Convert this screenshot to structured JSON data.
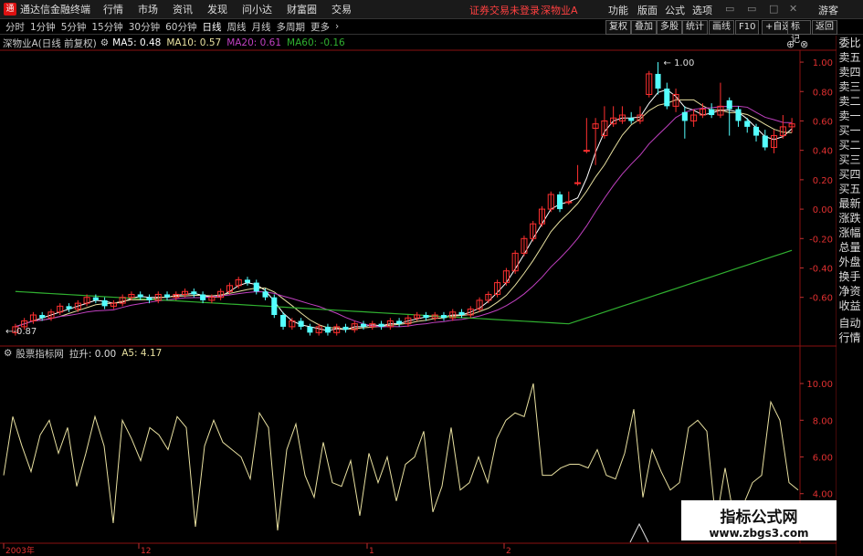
{
  "app": {
    "title": "通达信金融终端",
    "menu": [
      "行情",
      "市场",
      "资讯",
      "发现",
      "问小达",
      "财富圈",
      "交易"
    ],
    "login_status": "证券交易未登录",
    "stock_tag": "深物业A",
    "right_menu": [
      "功能",
      "版面",
      "公式",
      "选项"
    ],
    "guest": "游客"
  },
  "toolbar": {
    "periods": [
      "分时",
      "1分钟",
      "5分钟",
      "15分钟",
      "30分钟",
      "60分钟",
      "日线",
      "周线",
      "月线",
      "多周期",
      "更多"
    ],
    "active": "日线",
    "right_buttons": [
      "复权",
      "叠加",
      "多股",
      "统计",
      "画线",
      "F10",
      "+自选",
      "返回"
    ]
  },
  "main_info": {
    "title": "深物业A(日线 前复权)",
    "ma5_label": "MA5: 0.48",
    "ma10_label": "MA10: 0.57",
    "ma20_label": "MA20: 0.61",
    "ma60_label": "MA60: -0.16",
    "colors": {
      "ma5": "#ffffff",
      "ma10": "#e8e0a0",
      "ma20": "#c040c0",
      "ma60": "#30b030"
    }
  },
  "price_axis": [
    "1.00",
    "0.80",
    "0.60",
    "0.40",
    "0.20",
    "0.00",
    "-0.20",
    "-0.40",
    "-0.60"
  ],
  "annotations": {
    "high": "1.00",
    "low": "-0.87"
  },
  "sub_info": {
    "title": "股票指标网",
    "lift_label": "拉升: 0.00",
    "a5_label": "A5: 4.17"
  },
  "sub_axis": [
    "10.00",
    "8.00",
    "6.00",
    "4.00"
  ],
  "right_panel": [
    "委比",
    "卖五",
    "卖四",
    "卖三",
    "卖二",
    "卖一",
    "买一",
    "买二",
    "买三",
    "买四",
    "买五",
    "最新",
    "涨跌",
    "涨幅",
    "总量",
    "外盘",
    "换手",
    "净资",
    "收益"
  ],
  "right_panel_lower": [
    "自动",
    "行情"
  ],
  "date_labels": [
    "2003年",
    "12",
    "1",
    "2"
  ],
  "watermark": {
    "line1": "指标公式网",
    "line2": "www.zbgs3.com"
  },
  "chart_data": {
    "type": "candlestick",
    "ylim": [
      -0.9,
      1.05
    ],
    "candles": [
      [
        -0.84,
        -0.8,
        -0.78,
        -0.86
      ],
      [
        -0.8,
        -0.76,
        -0.74,
        -0.82
      ],
      [
        -0.76,
        -0.72,
        -0.7,
        -0.78
      ],
      [
        -0.72,
        -0.74,
        -0.7,
        -0.76
      ],
      [
        -0.74,
        -0.7,
        -0.68,
        -0.76
      ],
      [
        -0.7,
        -0.66,
        -0.64,
        -0.72
      ],
      [
        -0.66,
        -0.68,
        -0.64,
        -0.7
      ],
      [
        -0.68,
        -0.64,
        -0.62,
        -0.7
      ],
      [
        -0.64,
        -0.6,
        -0.58,
        -0.66
      ],
      [
        -0.6,
        -0.62,
        -0.58,
        -0.64
      ],
      [
        -0.62,
        -0.66,
        -0.6,
        -0.68
      ],
      [
        -0.66,
        -0.64,
        -0.62,
        -0.68
      ],
      [
        -0.64,
        -0.6,
        -0.58,
        -0.66
      ],
      [
        -0.6,
        -0.58,
        -0.56,
        -0.62
      ],
      [
        -0.58,
        -0.6,
        -0.56,
        -0.62
      ],
      [
        -0.6,
        -0.62,
        -0.58,
        -0.64
      ],
      [
        -0.62,
        -0.58,
        -0.56,
        -0.64
      ],
      [
        -0.58,
        -0.6,
        -0.56,
        -0.62
      ],
      [
        -0.6,
        -0.58,
        -0.56,
        -0.62
      ],
      [
        -0.58,
        -0.56,
        -0.54,
        -0.6
      ],
      [
        -0.56,
        -0.58,
        -0.54,
        -0.6
      ],
      [
        -0.58,
        -0.62,
        -0.56,
        -0.64
      ],
      [
        -0.62,
        -0.6,
        -0.58,
        -0.64
      ],
      [
        -0.6,
        -0.56,
        -0.54,
        -0.62
      ],
      [
        -0.56,
        -0.52,
        -0.5,
        -0.58
      ],
      [
        -0.52,
        -0.48,
        -0.46,
        -0.54
      ],
      [
        -0.48,
        -0.5,
        -0.46,
        -0.52
      ],
      [
        -0.5,
        -0.56,
        -0.48,
        -0.58
      ],
      [
        -0.56,
        -0.6,
        -0.54,
        -0.62
      ],
      [
        -0.6,
        -0.72,
        -0.58,
        -0.74
      ],
      [
        -0.72,
        -0.8,
        -0.7,
        -0.82
      ],
      [
        -0.8,
        -0.76,
        -0.74,
        -0.82
      ],
      [
        -0.76,
        -0.8,
        -0.74,
        -0.82
      ],
      [
        -0.8,
        -0.84,
        -0.78,
        -0.86
      ],
      [
        -0.84,
        -0.8,
        -0.78,
        -0.86
      ],
      [
        -0.8,
        -0.84,
        -0.78,
        -0.86
      ],
      [
        -0.84,
        -0.8,
        -0.78,
        -0.86
      ],
      [
        -0.8,
        -0.82,
        -0.78,
        -0.84
      ],
      [
        -0.82,
        -0.78,
        -0.76,
        -0.84
      ],
      [
        -0.78,
        -0.8,
        -0.76,
        -0.82
      ],
      [
        -0.8,
        -0.78,
        -0.76,
        -0.82
      ],
      [
        -0.78,
        -0.8,
        -0.76,
        -0.82
      ],
      [
        -0.8,
        -0.76,
        -0.74,
        -0.82
      ],
      [
        -0.76,
        -0.78,
        -0.74,
        -0.8
      ],
      [
        -0.78,
        -0.74,
        -0.72,
        -0.8
      ],
      [
        -0.74,
        -0.72,
        -0.7,
        -0.76
      ],
      [
        -0.72,
        -0.74,
        -0.7,
        -0.76
      ],
      [
        -0.74,
        -0.72,
        -0.7,
        -0.76
      ],
      [
        -0.72,
        -0.74,
        -0.7,
        -0.76
      ],
      [
        -0.74,
        -0.7,
        -0.68,
        -0.76
      ],
      [
        -0.7,
        -0.72,
        -0.68,
        -0.74
      ],
      [
        -0.72,
        -0.68,
        -0.66,
        -0.74
      ],
      [
        -0.68,
        -0.62,
        -0.6,
        -0.7
      ],
      [
        -0.62,
        -0.58,
        -0.56,
        -0.64
      ],
      [
        -0.58,
        -0.5,
        -0.48,
        -0.6
      ],
      [
        -0.5,
        -0.42,
        -0.4,
        -0.52
      ],
      [
        -0.42,
        -0.3,
        -0.28,
        -0.44
      ],
      [
        -0.3,
        -0.2,
        -0.18,
        -0.32
      ],
      [
        -0.2,
        -0.1,
        -0.08,
        -0.22
      ],
      [
        -0.1,
        0.0,
        0.02,
        -0.12
      ],
      [
        0.0,
        0.1,
        0.12,
        -0.02
      ],
      [
        0.1,
        0.0,
        0.12,
        -0.02
      ],
      [
        0.05,
        0.05,
        0.12,
        0.03
      ],
      [
        0.18,
        0.18,
        0.3,
        0.16
      ],
      [
        0.4,
        0.4,
        0.62,
        0.38
      ],
      [
        0.55,
        0.58,
        0.62,
        0.3
      ],
      [
        0.5,
        0.6,
        0.7,
        0.48
      ],
      [
        0.58,
        0.62,
        0.7,
        0.56
      ],
      [
        0.6,
        0.64,
        0.7,
        0.58
      ],
      [
        0.62,
        0.6,
        0.66,
        0.58
      ],
      [
        0.6,
        0.64,
        0.7,
        0.58
      ],
      [
        0.78,
        0.92,
        0.94,
        0.76
      ],
      [
        0.92,
        0.82,
        1.0,
        0.78
      ],
      [
        0.82,
        0.7,
        0.86,
        0.68
      ],
      [
        0.7,
        0.78,
        0.82,
        0.66
      ],
      [
        0.66,
        0.6,
        0.7,
        0.48
      ],
      [
        0.6,
        0.64,
        0.68,
        0.56
      ],
      [
        0.64,
        0.68,
        0.72,
        0.62
      ],
      [
        0.68,
        0.64,
        0.72,
        0.62
      ],
      [
        0.64,
        0.7,
        0.86,
        0.62
      ],
      [
        0.74,
        0.68,
        0.76,
        0.5
      ],
      [
        0.68,
        0.6,
        0.7,
        0.56
      ],
      [
        0.6,
        0.56,
        0.62,
        0.52
      ],
      [
        0.56,
        0.5,
        0.58,
        0.46
      ],
      [
        0.5,
        0.42,
        0.54,
        0.4
      ],
      [
        0.42,
        0.5,
        0.54,
        0.38
      ],
      [
        0.5,
        0.56,
        0.64,
        0.48
      ],
      [
        0.56,
        0.58,
        0.62,
        0.52
      ]
    ],
    "sub_values": [
      5.0,
      8.2,
      6.6,
      5.2,
      7.2,
      8.0,
      6.2,
      7.6,
      4.4,
      6.2,
      8.2,
      6.6,
      2.4,
      8.0,
      7.0,
      5.8,
      7.6,
      7.2,
      6.4,
      8.2,
      7.6,
      2.2,
      6.6,
      8.0,
      6.8,
      6.4,
      6.0,
      4.8,
      8.4,
      7.6,
      2.0,
      6.4,
      7.8,
      5.0,
      3.8,
      6.8,
      4.6,
      4.4,
      5.8,
      2.8,
      6.2,
      4.6,
      6.0,
      3.6,
      5.6,
      6.0,
      7.4,
      3.0,
      4.4,
      7.6,
      4.2,
      4.6,
      6.0,
      4.6,
      7.0,
      8.0,
      8.4,
      8.2,
      10.0,
      5.0,
      5.0,
      5.4,
      5.6,
      5.6,
      5.4,
      6.4,
      5.0,
      4.8,
      6.2,
      8.6,
      3.8,
      6.4,
      5.2,
      4.2,
      4.6,
      7.6,
      8.0,
      7.4,
      2.4,
      5.4,
      2.6,
      3.4,
      4.6,
      5.0,
      9.0,
      8.0,
      4.6,
      4.2
    ]
  }
}
